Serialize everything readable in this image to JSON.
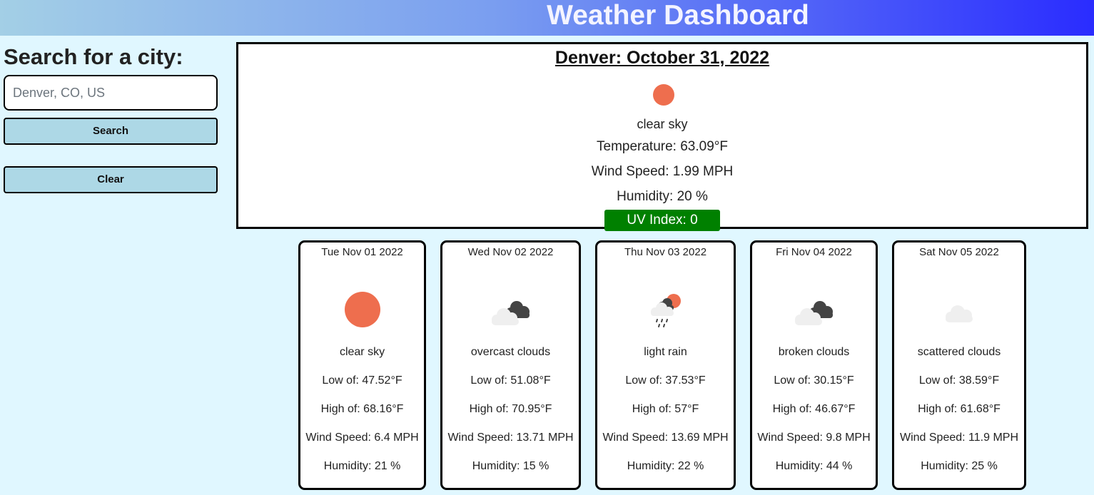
{
  "header": {
    "title": "Weather Dashboard"
  },
  "sidebar": {
    "heading": "Search for a city:",
    "search_placeholder": "Denver, CO, US",
    "search_label": "Search",
    "clear_label": "Clear"
  },
  "current": {
    "title": "Denver: October 31, 2022",
    "icon": "sun-icon",
    "description": "clear sky",
    "temperature": "Temperature: 63.09°F",
    "wind": "Wind Speed: 1.99 MPH",
    "humidity": "Humidity: 20 %",
    "uv": "UV Index: 0"
  },
  "forecast": [
    {
      "date": "Tue Nov 01 2022",
      "icon": "sun-icon",
      "description": "clear sky",
      "low": "Low of: 47.52°F",
      "high": "High of: 68.16°F",
      "wind": "Wind Speed: 6.4 MPH",
      "humidity": "Humidity: 21 %"
    },
    {
      "date": "Wed Nov 02 2022",
      "icon": "overcast-clouds-icon",
      "description": "overcast clouds",
      "low": "Low of: 51.08°F",
      "high": "High of: 70.95°F",
      "wind": "Wind Speed: 13.71 MPH",
      "humidity": "Humidity: 15 %"
    },
    {
      "date": "Thu Nov 03 2022",
      "icon": "light-rain-icon",
      "description": "light rain",
      "low": "Low of: 37.53°F",
      "high": "High of: 57°F",
      "wind": "Wind Speed: 13.69 MPH",
      "humidity": "Humidity: 22 %"
    },
    {
      "date": "Fri Nov 04 2022",
      "icon": "broken-clouds-icon",
      "description": "broken clouds",
      "low": "Low of: 30.15°F",
      "high": "High of: 46.67°F",
      "wind": "Wind Speed: 9.8 MPH",
      "humidity": "Humidity: 44 %"
    },
    {
      "date": "Sat Nov 05 2022",
      "icon": "scattered-clouds-icon",
      "description": "scattered clouds",
      "low": "Low of: 38.59°F",
      "high": "High of: 61.68°F",
      "wind": "Wind Speed: 11.9 MPH",
      "humidity": "Humidity: 25 %"
    }
  ],
  "colors": {
    "page_background": "#e0f7ff",
    "button_background": "#add8e6",
    "uv_badge": "#008000",
    "sun": "#ee6e4e",
    "cloud_light": "#efefef",
    "cloud_dark": "#444444"
  }
}
